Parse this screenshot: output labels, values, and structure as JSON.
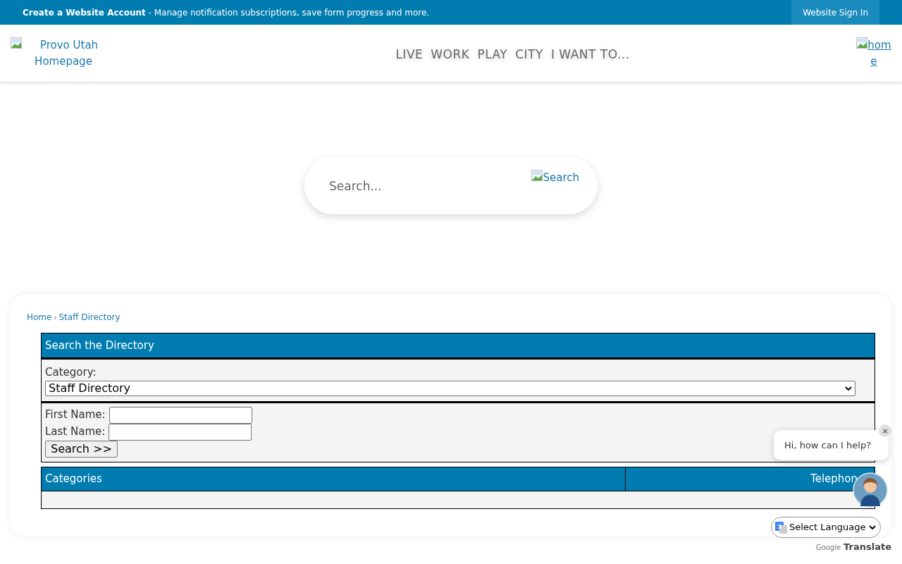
{
  "top_bar": {
    "account_link": "Create a Website Account",
    "account_text": " - Manage notification subscriptions, save form progress and more.",
    "sign_in": "Website Sign In"
  },
  "header": {
    "logo_alt": "Provo Utah Homepage",
    "nav": [
      "LIVE",
      "WORK",
      "PLAY",
      "CITY",
      "I WANT TO..."
    ],
    "home_alt": "home"
  },
  "search": {
    "placeholder": "Search...",
    "button_alt": "Search"
  },
  "breadcrumb": [
    "Home",
    "Staff Directory"
  ],
  "breadcrumb_separator": "›",
  "directory": {
    "title": "Search the Directory",
    "category_label": "Category:",
    "category_value": "Staff Directory",
    "first_name_label": "First Name:",
    "last_name_label": "Last Name:",
    "search_button": "Search >>"
  },
  "results_table": {
    "columns": [
      "Categories",
      "Telephon"
    ]
  },
  "chat": {
    "message": "Hi, how can I help?",
    "close": "×"
  },
  "translate": {
    "select": "Select Language",
    "brand": "Google",
    "label": "Translate"
  }
}
